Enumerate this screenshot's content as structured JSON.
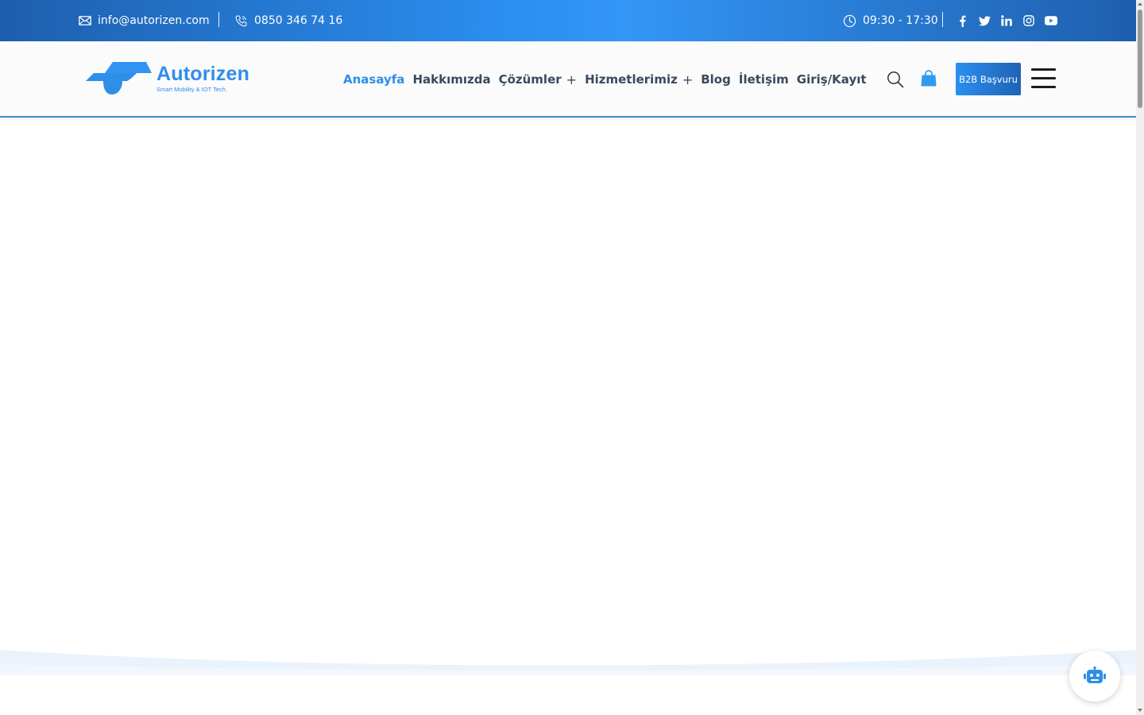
{
  "topbar": {
    "email": "info@autorizen.com",
    "phone": "0850 346 74 16",
    "hours": "09:30 - 17:30",
    "socials": [
      "facebook-icon",
      "twitter-icon",
      "linkedin-icon",
      "instagram-icon",
      "youtube-icon"
    ]
  },
  "header": {
    "logo_text": "Autorizen",
    "logo_tagline": "Smart Mobility & IOT Tech.",
    "nav": [
      {
        "label": "Anasayfa",
        "active": true,
        "has_children": false
      },
      {
        "label": "Hakkımızda",
        "active": false,
        "has_children": false
      },
      {
        "label": "Çözümler",
        "active": false,
        "has_children": true
      },
      {
        "label": "Hizmetlerimiz",
        "active": false,
        "has_children": true
      },
      {
        "label": "Blog",
        "active": false,
        "has_children": false
      },
      {
        "label": "İletişim",
        "active": false,
        "has_children": false
      },
      {
        "label": "Giriş/Kayıt",
        "active": false,
        "has_children": false
      }
    ],
    "nav_plus": "+",
    "b2b_label": "B2B Başvuru"
  },
  "colors": {
    "brand": "#2f8ee8",
    "topbar_dark": "#1e5fae",
    "nav_text": "#3a4a5c"
  }
}
